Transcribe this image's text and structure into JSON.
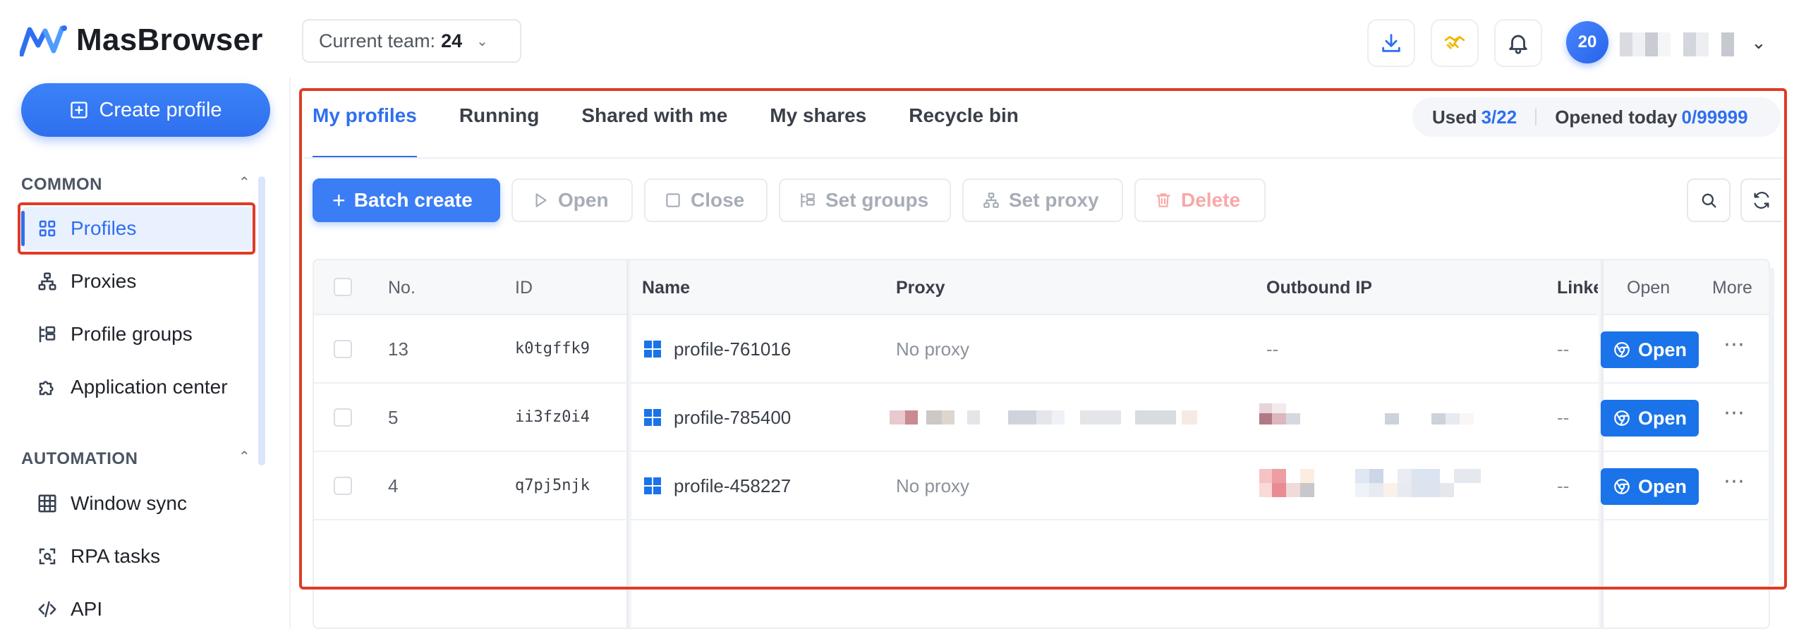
{
  "brand": {
    "name": "MasBrowser"
  },
  "team_select": {
    "prefix": "Current team: ",
    "value": "24"
  },
  "account": {
    "avatar_text": "20"
  },
  "sidebar": {
    "create_label": "Create profile",
    "sections": [
      {
        "label": "COMMON",
        "items": [
          {
            "label": "Profiles",
            "icon": "grid-icon",
            "active": true
          },
          {
            "label": "Proxies",
            "icon": "network-icon"
          },
          {
            "label": "Profile groups",
            "icon": "groups-icon"
          },
          {
            "label": "Application center",
            "icon": "puzzle-icon"
          }
        ]
      },
      {
        "label": "AUTOMATION",
        "items": [
          {
            "label": "Window sync",
            "icon": "table-grid-icon"
          },
          {
            "label": "RPA tasks",
            "icon": "scan-icon"
          },
          {
            "label": "API",
            "icon": "code-icon"
          }
        ]
      }
    ]
  },
  "tabs": [
    {
      "label": "My profiles",
      "active": true
    },
    {
      "label": "Running"
    },
    {
      "label": "Shared with me"
    },
    {
      "label": "My shares"
    },
    {
      "label": "Recycle bin"
    }
  ],
  "usage": {
    "used_label": "Used",
    "used_value": "3/22",
    "opened_label": "Opened today",
    "opened_value": "0/99999"
  },
  "toolbar": {
    "batch_create": "Batch create",
    "open": "Open",
    "close": "Close",
    "set_groups": "Set groups",
    "set_proxy": "Set proxy",
    "delete": "Delete"
  },
  "table": {
    "headers": {
      "no": "No.",
      "id": "ID",
      "name": "Name",
      "proxy": "Proxy",
      "outbound_ip": "Outbound IP",
      "linked": "Linke",
      "open": "Open",
      "more": "More"
    },
    "rows": [
      {
        "no": "13",
        "id": "k0tgffk9",
        "name": "profile-761016",
        "proxy": "No proxy",
        "outbound_ip": "--",
        "linked": "--",
        "open_label": "Open"
      },
      {
        "no": "5",
        "id": "ii3fz0i4",
        "name": "profile-785400",
        "proxy": "",
        "outbound_ip": "",
        "linked": "--",
        "open_label": "Open"
      },
      {
        "no": "4",
        "id": "q7pj5njk",
        "name": "profile-458227",
        "proxy": "No proxy",
        "outbound_ip": "",
        "linked": "--",
        "open_label": "Open"
      }
    ]
  },
  "colors": {
    "accent": "#2f6ff0",
    "open_button": "#1a73e8",
    "highlight": "#e03b24"
  }
}
